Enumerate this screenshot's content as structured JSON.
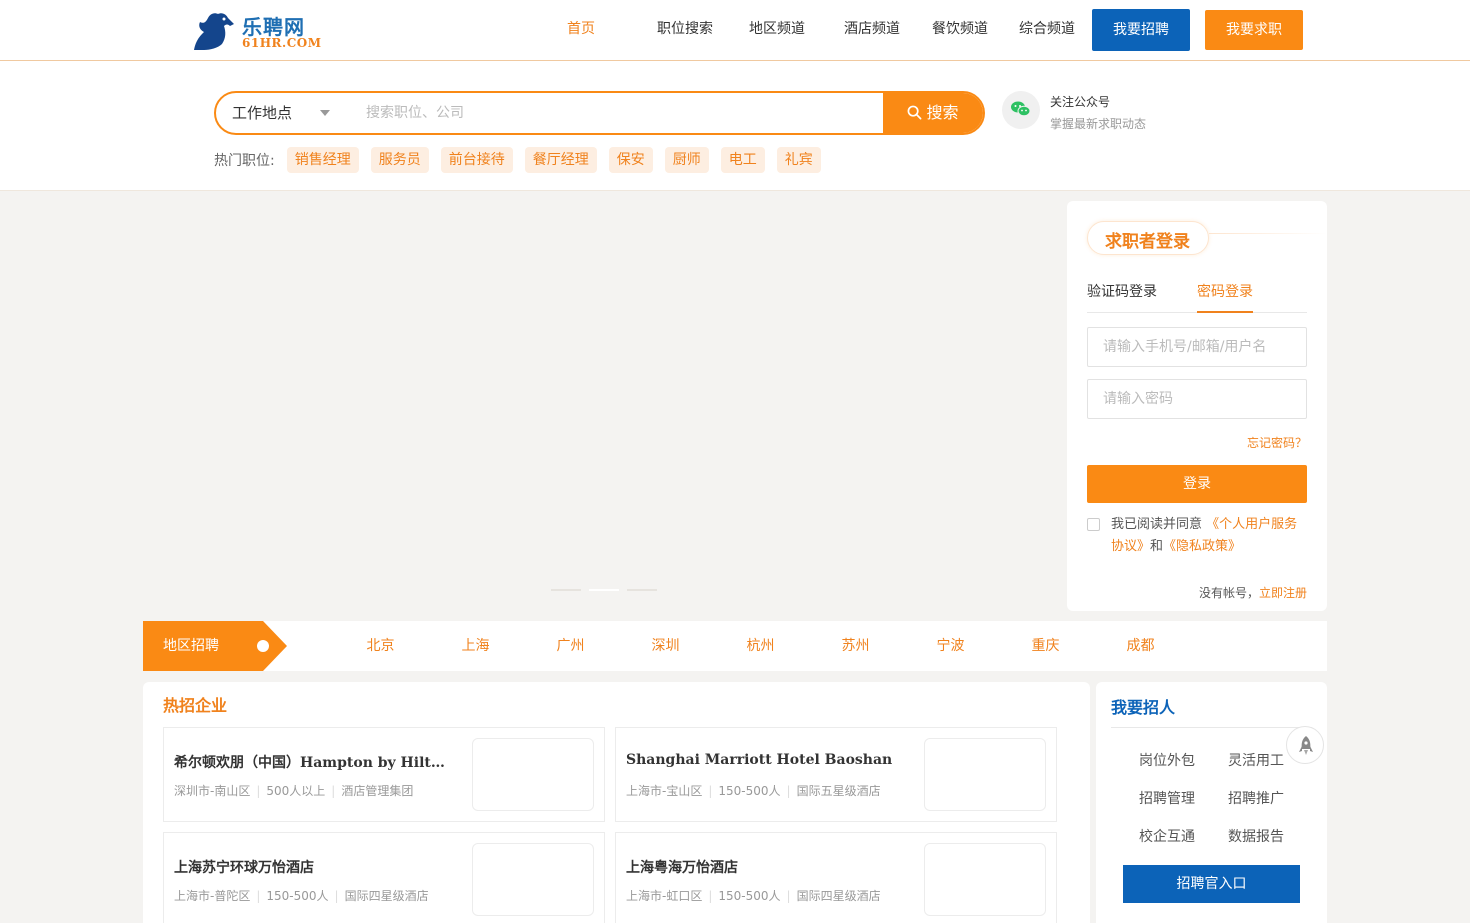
{
  "logo": {
    "cn": "乐聘网",
    "en": "61HR.COM"
  },
  "nav": [
    {
      "label": "首页",
      "active": true
    },
    {
      "label": "职位搜索",
      "active": false
    },
    {
      "label": "地区频道",
      "active": false
    },
    {
      "label": "酒店频道",
      "active": false
    },
    {
      "label": "餐饮频道",
      "active": false
    },
    {
      "label": "综合频道",
      "active": false
    }
  ],
  "header_buttons": {
    "recruit": "我要招聘",
    "job": "我要求职"
  },
  "search": {
    "location_label": "工作地点",
    "placeholder": "搜索职位、公司",
    "button": "搜索",
    "hot_label": "热门职位:",
    "hot_tags": [
      "销售经理",
      "服务员",
      "前台接待",
      "餐厅经理",
      "保安",
      "厨师",
      "电工",
      "礼宾"
    ]
  },
  "wechat": {
    "title": "关注公众号",
    "subtitle": "掌握最新求职动态"
  },
  "login": {
    "title": "求职者登录",
    "tab_code": "验证码登录",
    "tab_password": "密码登录",
    "username_placeholder": "请输入手机号/邮箱/用户名",
    "password_placeholder": "请输入密码",
    "forgot": "忘记密码？",
    "submit": "登录",
    "agree_prefix": "我已阅读并同意",
    "agree_link1": "《个人用户服务协议》",
    "agree_and": "和",
    "agree_link2": "《隐私政策》",
    "no_account": "没有帐号，",
    "register": "立即注册"
  },
  "region": {
    "label": "地区招聘",
    "cities": [
      "北京",
      "上海",
      "广州",
      "深圳",
      "杭州",
      "苏州",
      "宁波",
      "重庆",
      "成都"
    ]
  },
  "hot_companies": {
    "title": "热招企业",
    "items": [
      {
        "name": "希尔顿欢朋（中国）Hampton by Hilton (China)",
        "location": "深圳市-南山区",
        "size": "500人以上",
        "type": "酒店管理集团"
      },
      {
        "name": "Shanghai Marriott Hotel Baoshan",
        "location": "上海市-宝山区",
        "size": "150-500人",
        "type": "国际五星级酒店"
      },
      {
        "name": "上海苏宁环球万怡酒店",
        "location": "上海市-普陀区",
        "size": "150-500人",
        "type": "国际四星级酒店"
      },
      {
        "name": "上海粤海万怡酒店",
        "location": "上海市-虹口区",
        "size": "150-500人",
        "type": "国际四星级酒店"
      }
    ]
  },
  "recruiter": {
    "title": "我要招人",
    "items": [
      "岗位外包",
      "灵活用工",
      "招聘管理",
      "招聘推广",
      "校企互通",
      "数据报告"
    ],
    "button": "招聘官入口"
  },
  "colors": {
    "orange": "#fa8a14",
    "blue": "#0c63b8"
  }
}
